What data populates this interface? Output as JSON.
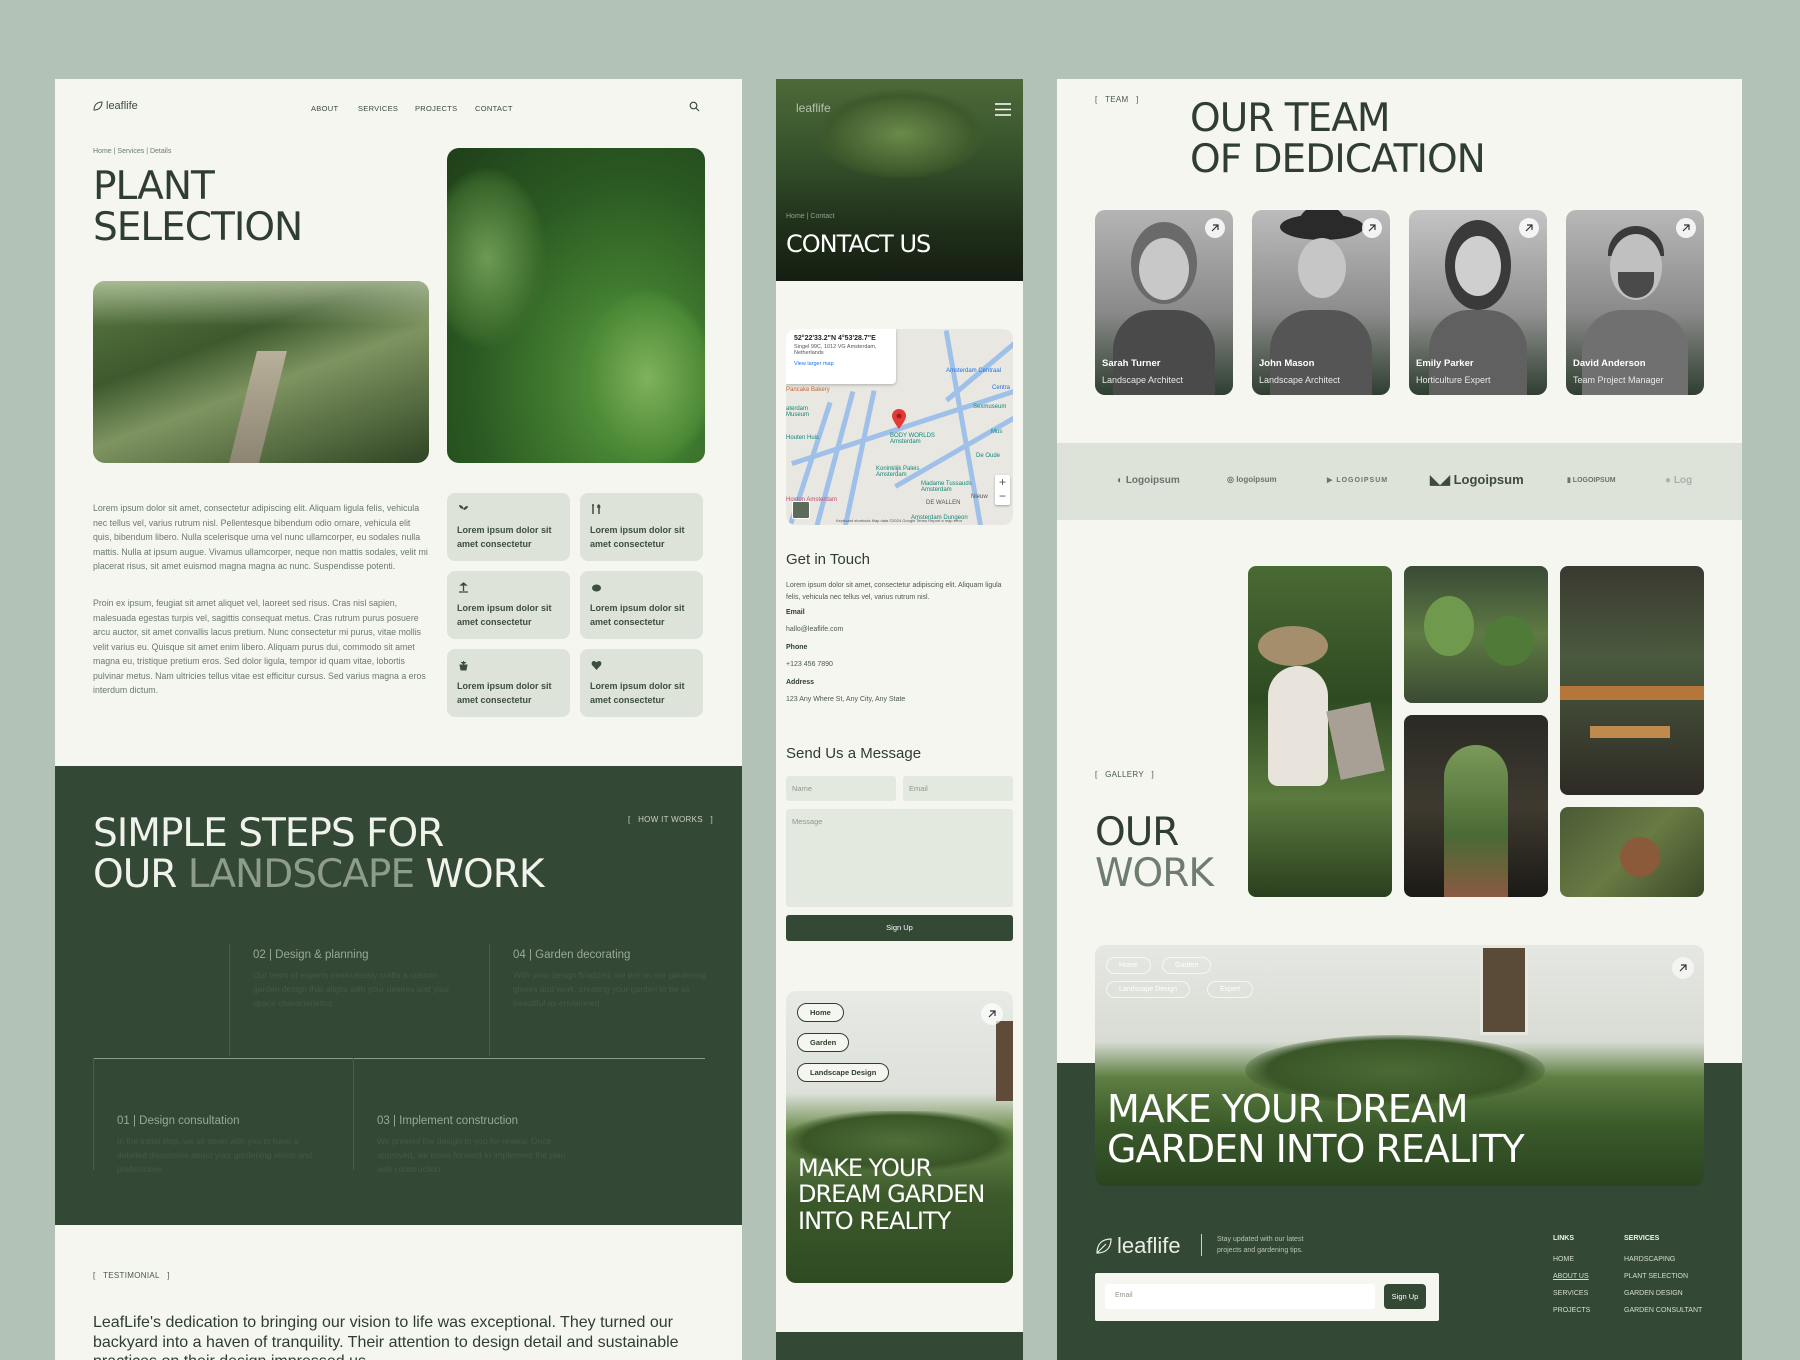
{
  "colors": {
    "background": "#b3c2b6",
    "panel": "#f4f6ef",
    "dark_green": "#344836",
    "card": "#dde3d8",
    "muted_text": "#7a8a7b"
  },
  "panel1": {
    "logo": "leaflife",
    "nav": [
      "ABOUT",
      "SERVICES",
      "PROJECTS",
      "CONTACT"
    ],
    "breadcrumb": [
      "Home",
      "Services",
      "Details"
    ],
    "title_line1": "PLANT",
    "title_line2": "SELECTION",
    "body_para1": "Lorem ipsum dolor sit amet, consectetur adipiscing elit. Aliquam ligula felis, vehicula nec tellus vel, varius rutrum nisl. Pellentesque bibendum odio ornare, vehicula elit quis, bibendum libero. Nulla scelerisque urna vel nunc ullamcorper, eu sodales nulla mattis. Nulla at ipsum augue. Vivamus ullamcorper, neque non mattis sodales, velit mi placerat risus, sit amet euismod magna magna ac nunc. Suspendisse potenti.",
    "body_para2": "Proin ex ipsum, feugiat sit amet aliquet vel, laoreet sed risus. Cras nisl sapien, malesuada egestas turpis vel, sagittis consequat metus. Cras rutrum purus posuere arcu auctor, sit amet convallis lacus pretium. Nunc consectetur mi purus, vitae mollis velit varius eu. Quisque sit amet enim libero. Aliquam purus dui, commodo sit amet magna eu, tristique pretium eros. Sed dolor ligula, tempor id quam vitae, lobortis pulvinar metus. Nam ultricies tellus vitae est efficitur cursus. Sed varius magna a eros interdum dictum.",
    "features": [
      {
        "icon": "plant-icon",
        "text": "Lorem ipsum dolor sit amet consectetur"
      },
      {
        "icon": "tools-icon",
        "text": "Lorem ipsum dolor sit amet consectetur"
      },
      {
        "icon": "sprout-icon",
        "text": "Lorem ipsum dolor sit amet consectetur"
      },
      {
        "icon": "soil-icon",
        "text": "Lorem ipsum dolor sit amet consectetur"
      },
      {
        "icon": "pot-icon",
        "text": "Lorem ipsum dolor sit amet consectetur"
      },
      {
        "icon": "leaf-heart-icon",
        "text": "Lorem ipsum dolor sit amet consectetur"
      }
    ],
    "how_it_works": "HOW IT WORKS",
    "steps_title_line1": "SIMPLE STEPS FOR",
    "steps_title_pre": "OUR",
    "steps_title_highlight": "LANDSCAPE",
    "steps_title_post": "WORK",
    "steps": [
      {
        "title": "02 | Design & planning",
        "desc": "Our team of experts meticulously crafts a custom garden design that aligns with your desires and your space characteristics."
      },
      {
        "title": "04 | Garden decorating",
        "desc": "With your design finalized, we put on our gardening gloves and work, creating your garden to be as beautiful as envisioned."
      },
      {
        "title": "01 | Design consultation",
        "desc": "In the initial step, we sit down with you to have a detailed discussion about your gardening vision and preferences."
      },
      {
        "title": "03 | Implement construction",
        "desc": "We present the design to you for review. Once approved, we move forward to implement the plan with construction."
      }
    ],
    "testimonial_label": "TESTIMONIAL",
    "testimonial_text": "LeafLife's dedication to bringing our vision to life was exceptional. They turned our backyard into a haven of tranquility. Their attention to design detail and sustainable practices on their design impressed us."
  },
  "panel2": {
    "logo": "leaflife",
    "breadcrumb": [
      "Home",
      "Contact"
    ],
    "title": "CONTACT US",
    "map": {
      "coords": "52°22'33.2\"N 4°53'28.7\"E",
      "address": "Singel 99C, 1012 VG Amsterdam, Netherlands",
      "link": "View larger map",
      "labels": [
        "Pancake Bakery",
        "Amsterdam Centraal",
        "Centra",
        "Sexmuseum",
        "BODY WORLDS Amsterdam",
        "Koninklijk Paleis Amsterdam",
        "Madame Tussauds Amsterdam",
        "De Oude",
        "Hoxton Amsterdam",
        "DE WALLEN",
        "Nieuw",
        "Amsterdam Dungeon",
        "Houten Huis",
        "Mus",
        "aterdam Museum"
      ],
      "footer": "Keyboard shortcuts   Map data ©2024 Google   Terms   Report a map error"
    },
    "get_in_touch": "Get in Touch",
    "touch_desc": "Lorem ipsum dolor sit amet, consectetur adipiscing elit. Aliquam ligula felis, vehicula nec tellus vel, varius rutrum nisl.",
    "email_label": "Email",
    "email": "hallo@leaflife.com",
    "phone_label": "Phone",
    "phone": "+123 456 7890",
    "address_label": "Address",
    "address": "123 Any Where St, Any City, Any State",
    "send_title": "Send Us a Message",
    "name_placeholder": "Name",
    "email_placeholder": "Email",
    "message_placeholder": "Message",
    "submit": "Sign Up",
    "pills": [
      "Home",
      "Garden",
      "Landscape Design"
    ],
    "cta_title": "MAKE YOUR DREAM GARDEN INTO REALITY"
  },
  "panel3": {
    "team_label": "TEAM",
    "team_title_line1": "OUR TEAM",
    "team_title_line2": "OF DEDICATION",
    "members": [
      {
        "name": "Sarah Turner",
        "role": "Landscape Architect"
      },
      {
        "name": "John Mason",
        "role": "Landscape Architect"
      },
      {
        "name": "Emily Parker",
        "role": "Horticulture Expert"
      },
      {
        "name": "David Anderson",
        "role": "Team Project Manager"
      }
    ],
    "logos": [
      "Logoipsum",
      "logoipsum",
      "LOGOIPSUM",
      "Logoipsum",
      "LOGOIPSUM",
      "Log"
    ],
    "gallery_label": "GALLERY",
    "work_line1": "OUR",
    "work_line2": "WORK",
    "tags": [
      "Home",
      "Garden",
      "Landscape Design",
      "Expert"
    ],
    "cta_title_line1": "MAKE YOUR DREAM",
    "cta_title_line2": "GARDEN INTO REALITY",
    "footer_logo": "leaflife",
    "footer_tagline": "Stay updated with our latest projects and gardening tips.",
    "footer_email_placeholder": "Email",
    "footer_submit": "Sign Up",
    "links_title": "LINKS",
    "links": [
      "HOME",
      "ABOUT US",
      "SERVICES",
      "PROJECTS"
    ],
    "services_title": "SERVICES",
    "services": [
      "HARDSCAPING",
      "PLANT SELECTION",
      "GARDEN DESIGN",
      "GARDEN CONSULTANT"
    ]
  }
}
